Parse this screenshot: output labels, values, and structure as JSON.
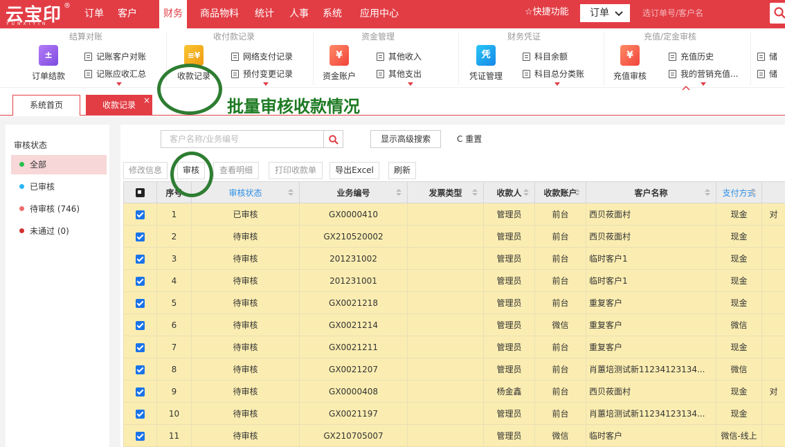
{
  "logo": {
    "main": "云宝印",
    "mark": "®",
    "sub": "YUNXIYIN"
  },
  "nav": {
    "items": [
      "订单",
      "客户",
      "财务",
      "商品物料",
      "统计",
      "人事",
      "系统",
      "应用中心"
    ],
    "active_index": 2,
    "quick": "☆快捷功能",
    "order_select": "订单",
    "search_placeholder": "选订单号/客户名"
  },
  "ribbon": {
    "groups": [
      {
        "title": "结算对账"
      },
      {
        "title": "收付款记录"
      },
      {
        "title": "资金管理"
      },
      {
        "title": "财务凭证"
      },
      {
        "title": "充值/定金审核"
      }
    ],
    "big": {
      "order_settle": "订单结款",
      "payment_records": "收款记录",
      "fund_account": "资金账户",
      "voucher": "凭证管理",
      "recharge_audit": "充值审核"
    },
    "small": {
      "credit_reconcile": "记账客户对账",
      "credit_receivable": "记账应收汇总",
      "online_payment": "网络支付记录",
      "prepay_change": "预付变更记录",
      "other_income": "其他收入",
      "other_expense": "其他支出",
      "subject_balance": "科目余额",
      "subject_ledger": "科目总分类账",
      "recharge_history": "充值历史",
      "my_recharge": "我的营销充值...",
      "stored_1": "储",
      "stored_2": "储"
    }
  },
  "tabs": {
    "home": "系统首页",
    "active": "收款记录",
    "close": "×"
  },
  "annotation": "批量审核收款情况",
  "left": {
    "title": "审核状态",
    "items": [
      {
        "label": "全部",
        "color": "#27c24c"
      },
      {
        "label": "已审核",
        "color": "#29b6f6"
      },
      {
        "label": "待审核 (746)",
        "color": "#f06b6b"
      },
      {
        "label": "未通过 (0)",
        "color": "#d32f2f"
      }
    ]
  },
  "search": {
    "placeholder": "客户名称/业务编号",
    "advanced": "显示高级搜索",
    "reset": "C 重置"
  },
  "actions": {
    "edit": "修改信息",
    "audit": "审核",
    "detail": "查看明细",
    "print": "打印收款单",
    "export": "导出Excel",
    "refresh": "刷新"
  },
  "table": {
    "columns": [
      "",
      "序号",
      "审核状态",
      "业务编号",
      "发票类型",
      "收款人",
      "收款账户",
      "客户名称",
      "支付方式",
      ""
    ],
    "rows": [
      [
        "1",
        "已审核",
        "GX0000410",
        "",
        "管理员",
        "前台",
        "西贝莜面村",
        "现金",
        "对"
      ],
      [
        "2",
        "待审核",
        "GX210520002",
        "",
        "管理员",
        "前台",
        "西贝莜面村",
        "现金",
        ""
      ],
      [
        "3",
        "待审核",
        "201231002",
        "",
        "管理员",
        "前台",
        "临时客户1",
        "现金",
        ""
      ],
      [
        "4",
        "待审核",
        "201231001",
        "",
        "管理员",
        "前台",
        "临时客户1",
        "现金",
        ""
      ],
      [
        "5",
        "待审核",
        "GX0021218",
        "",
        "管理员",
        "前台",
        "重复客户",
        "现金",
        ""
      ],
      [
        "6",
        "待审核",
        "GX0021214",
        "",
        "管理员",
        "微信",
        "重复客户",
        "微信",
        ""
      ],
      [
        "7",
        "待审核",
        "GX0021211",
        "",
        "管理员",
        "前台",
        "重复客户",
        "现金",
        ""
      ],
      [
        "8",
        "待审核",
        "GX0021207",
        "",
        "管理员",
        "前台",
        "肖蕙培测试新11234123134...",
        "微信",
        ""
      ],
      [
        "9",
        "待审核",
        "GX0000408",
        "",
        "杨金鑫",
        "前台",
        "西贝莜面村",
        "现金",
        "对"
      ],
      [
        "10",
        "待审核",
        "GX0021197",
        "",
        "管理员",
        "前台",
        "肖蕙培测试新11234123134...",
        "现金",
        ""
      ],
      [
        "11",
        "待审核",
        "GX210705007",
        "",
        "管理员",
        "微信",
        "临时客户",
        "微信-线上",
        ""
      ]
    ]
  }
}
